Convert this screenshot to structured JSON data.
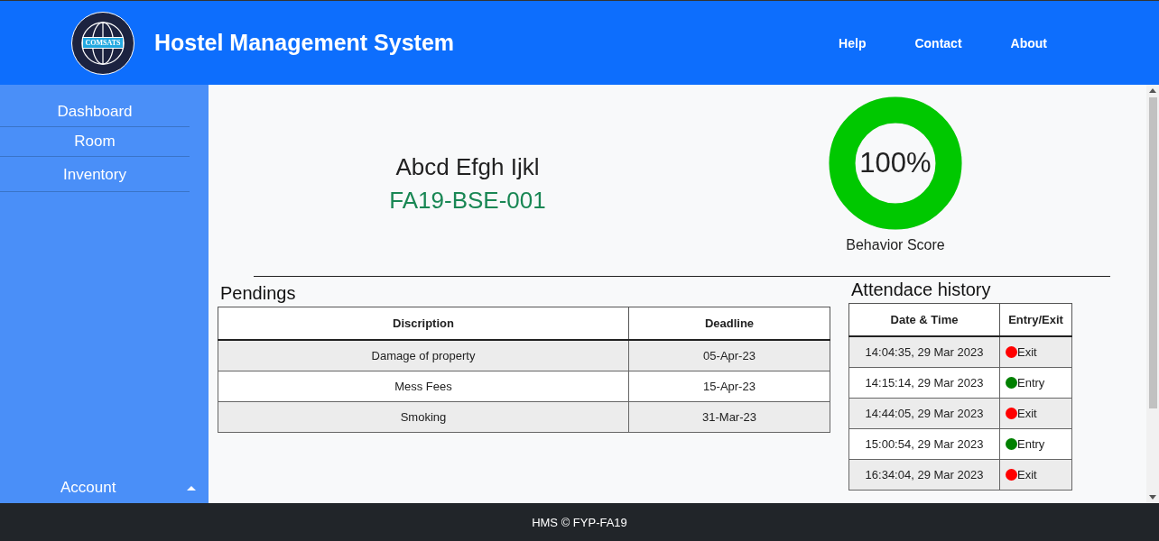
{
  "header": {
    "logo_text": "COMSATS",
    "title": "Hostel Management System",
    "nav": [
      "Help",
      "Contact",
      "About"
    ]
  },
  "sidebar": {
    "items": [
      "Dashboard",
      "Room",
      "Inventory"
    ],
    "account": {
      "label": "Account",
      "expanded": true
    }
  },
  "profile": {
    "name": "Abcd Efgh Ijkl",
    "reg_no": "FA19-BSE-001"
  },
  "behavior": {
    "level": 1,
    "reading": "100%",
    "label": "Behavior Score"
  },
  "pendings": {
    "title": "Pendings",
    "columns": [
      "Discription",
      "Deadline"
    ],
    "rows": [
      {
        "cells": [
          "Damage of property",
          "05-Apr-23"
        ]
      },
      {
        "cells": [
          "Mess Fees",
          "15-Apr-23"
        ]
      },
      {
        "cells": [
          "Smoking",
          "31-Mar-23"
        ]
      }
    ]
  },
  "attendance": {
    "title": "Attendace history",
    "columns": [
      "Date & Time",
      "Entry/Exit"
    ],
    "rows": [
      {
        "time": "14:04:35, 29 Mar 2023",
        "status": "Exit",
        "color": "#ff0000"
      },
      {
        "time": "14:15:14, 29 Mar 2023",
        "status": "Entry",
        "color": "#008000"
      },
      {
        "time": "14:44:05, 29 Mar 2023",
        "status": "Exit",
        "color": "#ff0000"
      },
      {
        "time": "15:00:54, 29 Mar 2023",
        "status": "Entry",
        "color": "#008000"
      },
      {
        "time": "16:34:04, 29 Mar 2023",
        "status": "Exit",
        "color": "#ff0000"
      }
    ]
  },
  "footer": {
    "text": "HMS © FYP-FA19"
  }
}
